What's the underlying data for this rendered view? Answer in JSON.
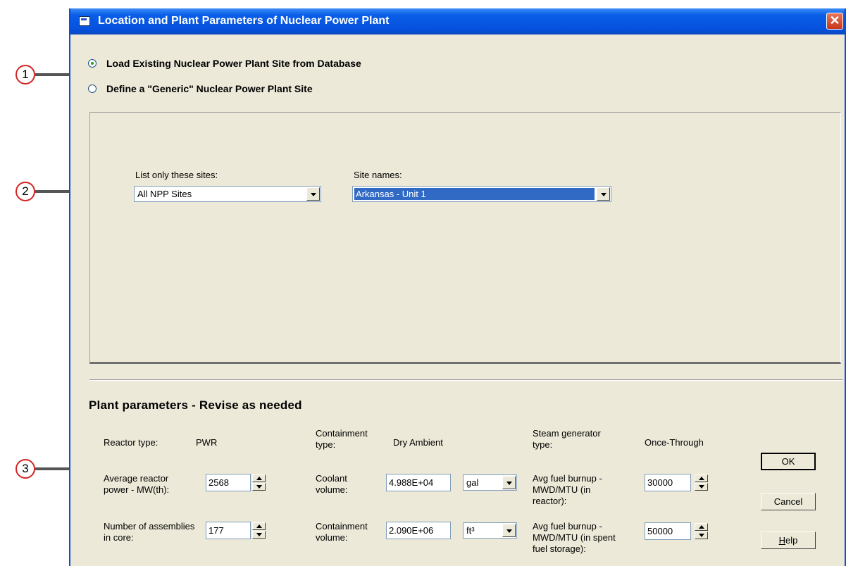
{
  "window": {
    "title": "Location and Plant Parameters of Nuclear Power Plant",
    "close_symbol": "✕"
  },
  "source": {
    "options": [
      {
        "label": "Load Existing Nuclear Power Plant Site from Database",
        "selected": true
      },
      {
        "label": "Define a \"Generic\" Nuclear Power Plant Site",
        "selected": false
      }
    ]
  },
  "site_selection": {
    "filter_label": "List only these sites:",
    "filter_value": "All NPP Sites",
    "site_label": "Site names:",
    "site_value": "Arkansas - Unit 1"
  },
  "plant": {
    "section_title": "Plant parameters - Revise as needed",
    "reactor_type_label": "Reactor type:",
    "reactor_type_value": "PWR",
    "containment_type_label": "Containment type:",
    "containment_type_value": "Dry Ambient",
    "steam_gen_label": "Steam generator type:",
    "steam_gen_value": "Once-Through",
    "power_label": "Average reactor power - MW(th):",
    "power_value": "2568",
    "coolant_label": "Coolant volume:",
    "coolant_value": "4.988E+04",
    "coolant_unit": "gal",
    "burnup_reactor_label": "Avg fuel burnup - MWD/MTU (in reactor):",
    "burnup_reactor_value": "30000",
    "assemblies_label": "Number of assemblies in core:",
    "assemblies_value": "177",
    "containment_vol_label": "Containment volume:",
    "containment_vol_value": "2.090E+06",
    "containment_vol_unit": "ft³",
    "burnup_storage_label": "Avg fuel burnup - MWD/MTU (in spent fuel storage):",
    "burnup_storage_value": "50000"
  },
  "buttons": {
    "ok": "OK",
    "cancel": "Cancel",
    "help_prefix": "H",
    "help_rest": "elp"
  },
  "callouts": [
    "1",
    "2",
    "3"
  ],
  "colors": {
    "titlebar": "#0551dd",
    "dialog_bg": "#ece9d8",
    "selection": "#316ac5",
    "callout_border": "#d22424"
  }
}
